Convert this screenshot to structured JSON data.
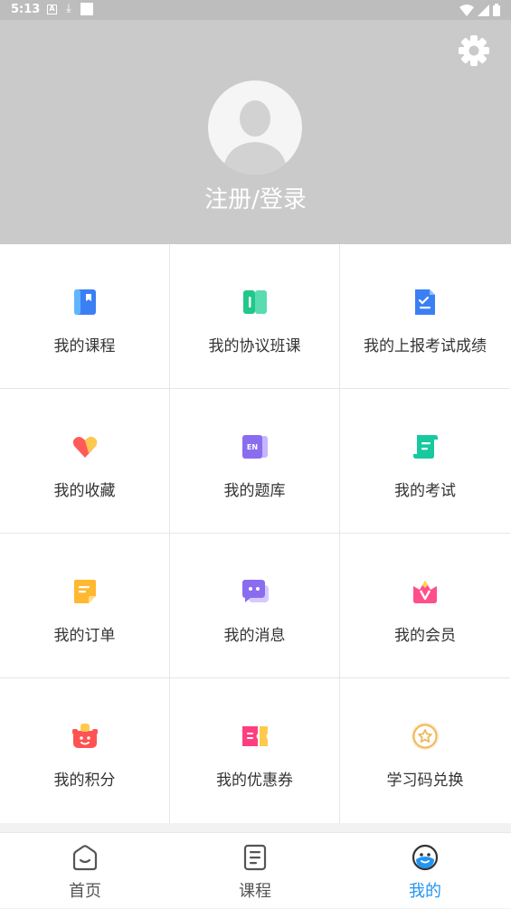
{
  "status_bar": {
    "time": "5:13",
    "a_icon": "A"
  },
  "header": {
    "login_label": "注册/登录"
  },
  "menu": [
    {
      "label": "我的课程",
      "icon": "course-book-icon"
    },
    {
      "label": "我的协议班课",
      "icon": "agreement-class-icon"
    },
    {
      "label": "我的上报考试成绩",
      "icon": "exam-report-icon"
    },
    {
      "label": "我的收藏",
      "icon": "favorite-heart-icon"
    },
    {
      "label": "我的题库",
      "icon": "question-bank-icon"
    },
    {
      "label": "我的考试",
      "icon": "exam-scroll-icon"
    },
    {
      "label": "我的订单",
      "icon": "order-note-icon"
    },
    {
      "label": "我的消息",
      "icon": "message-bubble-icon"
    },
    {
      "label": "我的会员",
      "icon": "vip-crown-icon"
    },
    {
      "label": "我的积分",
      "icon": "points-gift-icon"
    },
    {
      "label": "我的优惠券",
      "icon": "coupon-ticket-icon"
    },
    {
      "label": "学习码兑换",
      "icon": "redeem-star-icon"
    }
  ],
  "tabs": [
    {
      "label": "首页",
      "icon": "home-icon"
    },
    {
      "label": "课程",
      "icon": "course-icon"
    },
    {
      "label": "我的",
      "icon": "profile-face-icon"
    }
  ],
  "colors": {
    "header_bg": "#cacaca",
    "active_tab": "#2196f3"
  }
}
